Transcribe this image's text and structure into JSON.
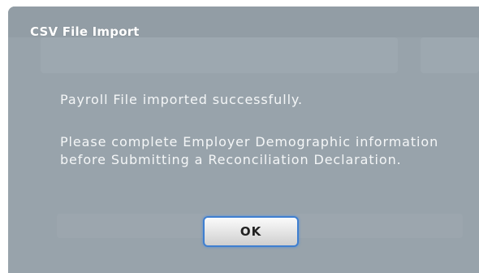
{
  "dialog": {
    "title": "CSV File Import",
    "message_line1": "Payroll File imported successfully.",
    "message_line2": "Please complete Employer Demographic information before Submitting a Reconciliation Declaration.",
    "ok_label": "OK"
  },
  "colors": {
    "dialog_background": "#98a3ab",
    "text": "#f4f6f7",
    "button_border": "#3f7fd0"
  }
}
